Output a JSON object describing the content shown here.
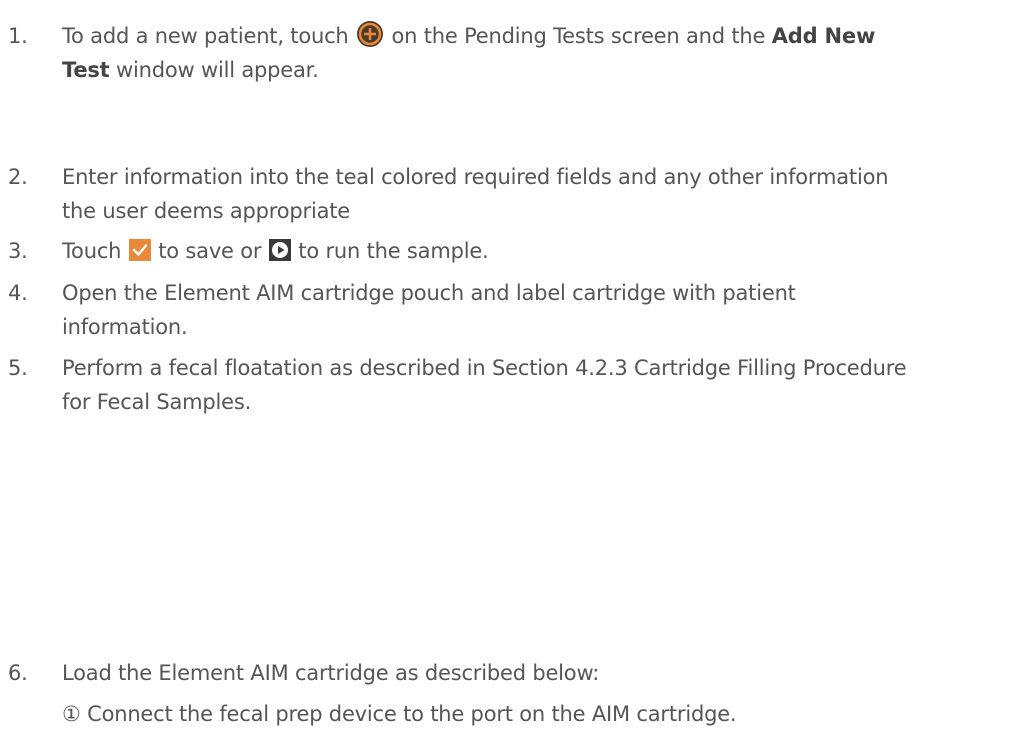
{
  "steps": [
    {
      "num": "1.",
      "t1": "To add a new patient, touch",
      "t2": "on the Pending Tests screen and the",
      "bold1": "Add New",
      "bold2": "Test",
      "t3": "window will appear."
    },
    {
      "num": "2.",
      "line1": "Enter information into the teal colored required fields and any other information",
      "line2": "the user deems appropriate"
    },
    {
      "num": "3.",
      "t1": "Touch",
      "t2": "to save or",
      "t3": "to run the sample."
    },
    {
      "num": "4.",
      "line1": "Open the Element AIM cartridge pouch and label cartridge with patient",
      "line2": "information."
    },
    {
      "num": "5.",
      "line1": "Perform a fecal floatation as described in Section 4.2.3 Cartridge Filling Procedure",
      "line2": "for Fecal Samples."
    },
    {
      "num": "6.",
      "line1": "Load the Element AIM cartridge as described below:"
    }
  ],
  "substep": "① Connect the fecal prep device to the port on the AIM cartridge.",
  "icons": {
    "add": "plus-circle-icon",
    "save": "checkmark-icon",
    "run": "play-icon"
  },
  "colors": {
    "text": "#555555",
    "accent_orange": "#e8893a",
    "run_dark": "#3a3a3a"
  }
}
